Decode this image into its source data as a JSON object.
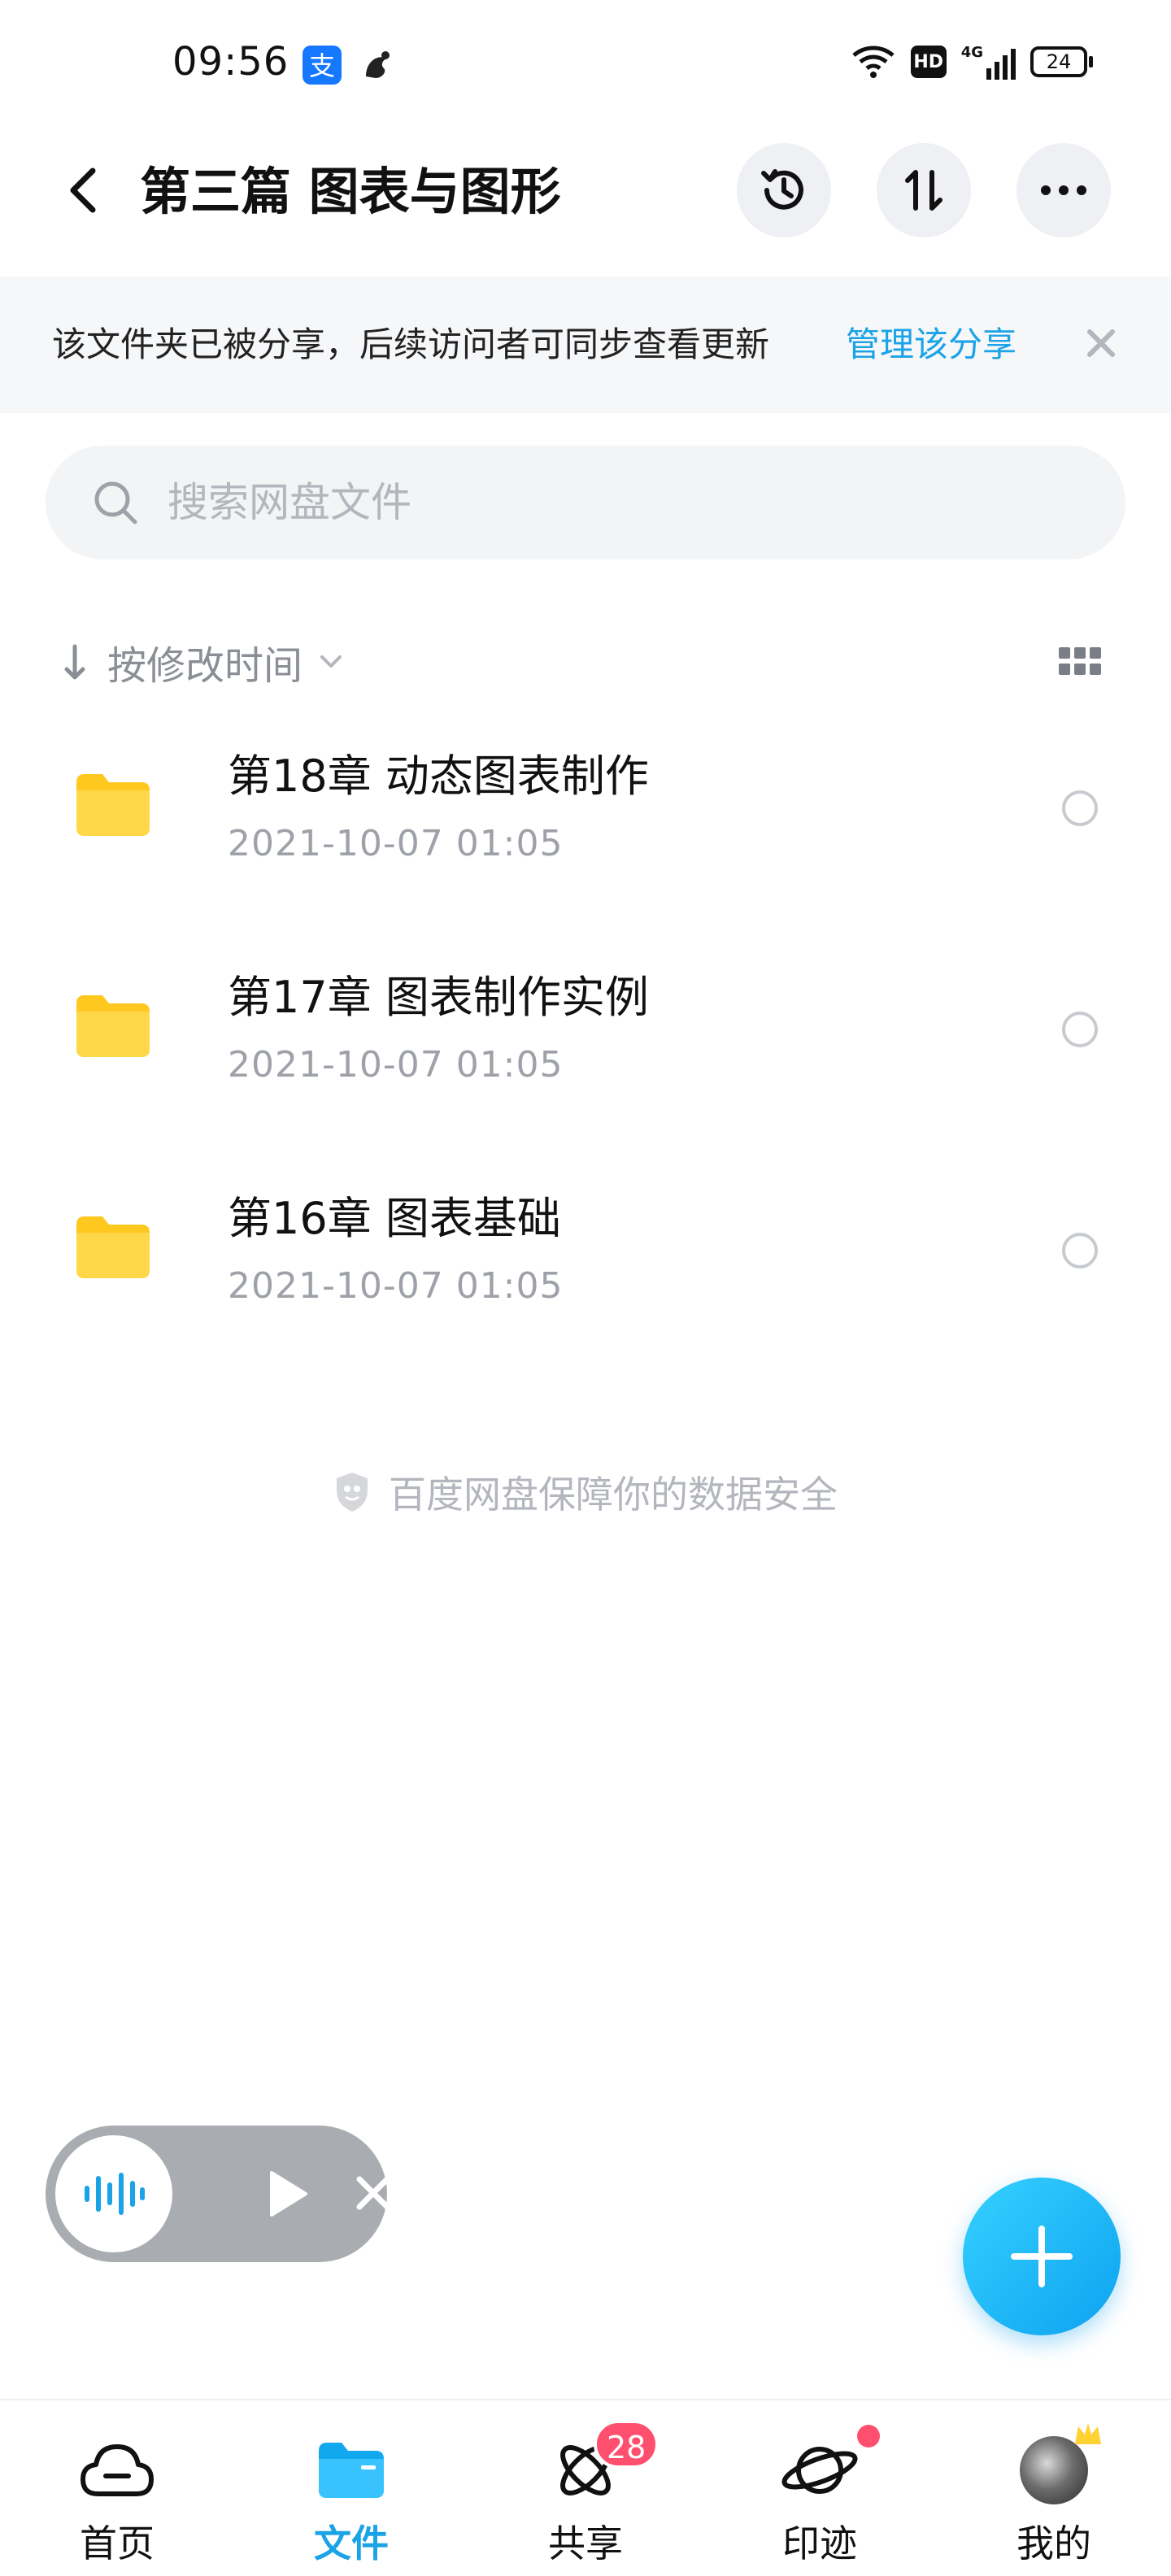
{
  "status_bar": {
    "time": "09:56",
    "app_icons": [
      "alipay-icon",
      "uc-browser-icon"
    ],
    "hd_label": "HD",
    "network_label": "4G",
    "battery": "24"
  },
  "header": {
    "title": "第三篇 图表与图形",
    "buttons": [
      "history-icon",
      "transfer-icon",
      "more-icon"
    ]
  },
  "share_notice": {
    "text": "该文件夹已被分享，后续访问者可同步查看更新",
    "link_label": "管理该分享"
  },
  "search": {
    "placeholder": "搜索网盘文件"
  },
  "sort": {
    "label": "按修改时间"
  },
  "files": [
    {
      "name": "第18章 动态图表制作",
      "date": "2021-10-07  01:05"
    },
    {
      "name": "第17章 图表制作实例",
      "date": "2021-10-07  01:05"
    },
    {
      "name": "第16章 图表基础",
      "date": "2021-10-07  01:05"
    }
  ],
  "safety_text": "百度网盘保障你的数据安全",
  "bottom_nav": {
    "items": [
      {
        "label": "首页",
        "icon": "cloud-icon",
        "active": false
      },
      {
        "label": "文件",
        "icon": "folder-icon",
        "active": true
      },
      {
        "label": "共享",
        "icon": "share-atom-icon",
        "active": false,
        "badge": "28"
      },
      {
        "label": "印迹",
        "icon": "planet-icon",
        "active": false,
        "dot": true
      },
      {
        "label": "我的",
        "icon": "avatar",
        "active": false
      }
    ]
  },
  "colors": {
    "accent": "#1aa3e6",
    "folder": "#ffd233",
    "badge": "#ff4f6e"
  }
}
